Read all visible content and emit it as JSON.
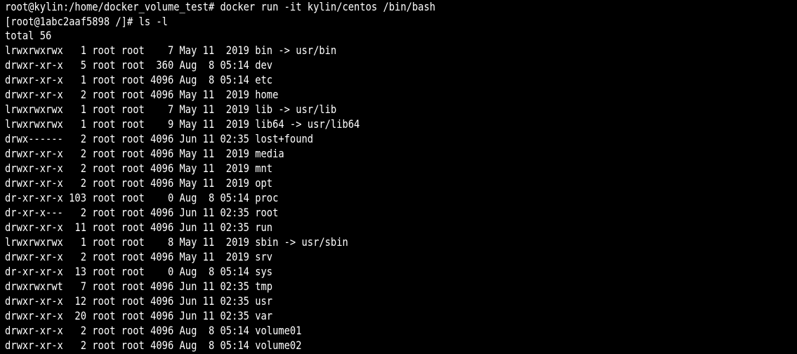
{
  "terminal": {
    "background": "#000000",
    "foreground": "#ffffff",
    "lines": [
      "root@kylin:/home/docker_volume_test# docker run -it kylin/centos /bin/bash",
      "[root@1abc2aaf5898 /]# ls -l",
      "total 56",
      "lrwxrwxrwx   1 root root    7 May 11  2019 bin -> usr/bin",
      "drwxr-xr-x   5 root root  360 Aug  8 05:14 dev",
      "drwxr-xr-x   1 root root 4096 Aug  8 05:14 etc",
      "drwxr-xr-x   2 root root 4096 May 11  2019 home",
      "lrwxrwxrwx   1 root root    7 May 11  2019 lib -> usr/lib",
      "lrwxrwxrwx   1 root root    9 May 11  2019 lib64 -> usr/lib64",
      "drwx------   2 root root 4096 Jun 11 02:35 lost+found",
      "drwxr-xr-x   2 root root 4096 May 11  2019 media",
      "drwxr-xr-x   2 root root 4096 May 11  2019 mnt",
      "drwxr-xr-x   2 root root 4096 May 11  2019 opt",
      "dr-xr-xr-x 103 root root    0 Aug  8 05:14 proc",
      "dr-xr-x---   2 root root 4096 Jun 11 02:35 root",
      "drwxr-xr-x  11 root root 4096 Jun 11 02:35 run",
      "lrwxrwxrwx   1 root root    8 May 11  2019 sbin -> usr/sbin",
      "drwxr-xr-x   2 root root 4096 May 11  2019 srv",
      "dr-xr-xr-x  13 root root    0 Aug  8 05:14 sys",
      "drwxrwxrwt   7 root root 4096 Jun 11 02:35 tmp",
      "drwxr-xr-x  12 root root 4096 Jun 11 02:35 usr",
      "drwxr-xr-x  20 root root 4096 Jun 11 02:35 var",
      "drwxr-xr-x   2 root root 4096 Aug  8 05:14 volume01",
      "drwxr-xr-x   2 root root 4096 Aug  8 05:14 volume02"
    ]
  }
}
